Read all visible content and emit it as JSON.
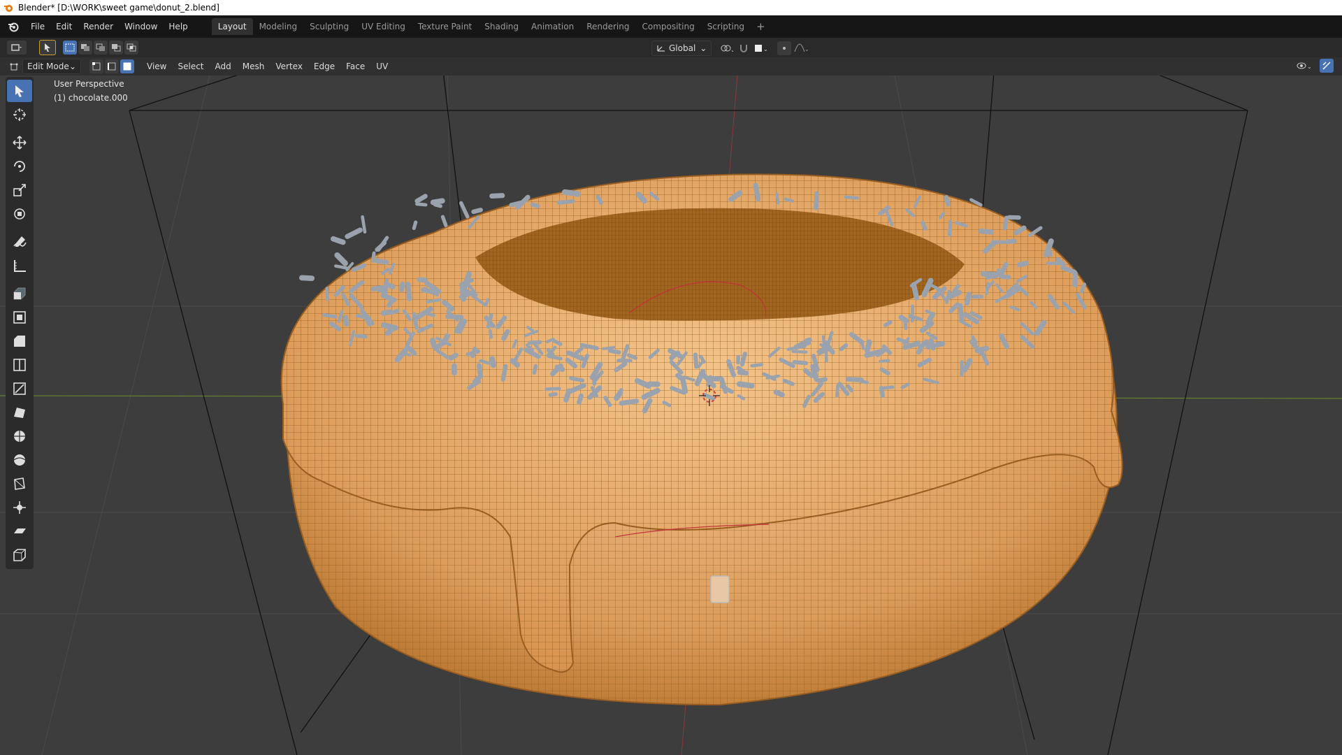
{
  "window": {
    "title": "Blender* [D:\\WORK\\sweet game\\donut_2.blend]"
  },
  "menu": [
    "File",
    "Edit",
    "Render",
    "Window",
    "Help"
  ],
  "workspaces": [
    "Layout",
    "Modeling",
    "Sculpting",
    "UV Editing",
    "Texture Paint",
    "Shading",
    "Animation",
    "Rendering",
    "Compositing",
    "Scripting"
  ],
  "active_workspace": "Layout",
  "add_workspace": "+",
  "toolbar": {
    "transform_orientation": "Global"
  },
  "edit_header": {
    "mode": "Edit Mode",
    "menus": [
      "View",
      "Select",
      "Add",
      "Mesh",
      "Vertex",
      "Edge",
      "Face",
      "UV"
    ]
  },
  "viewport": {
    "perspective": "User Perspective",
    "object": "(1) chocolate.000"
  },
  "tools": [
    {
      "name": "select-box-icon",
      "active": true
    },
    {
      "name": "cursor-icon"
    },
    {
      "name": "move-icon"
    },
    {
      "name": "rotate-icon"
    },
    {
      "name": "scale-icon"
    },
    {
      "name": "transform-icon"
    },
    {
      "name": "annotate-icon"
    },
    {
      "name": "measure-icon"
    },
    {
      "name": "extrude-icon"
    },
    {
      "name": "inset-icon"
    },
    {
      "name": "bevel-icon"
    },
    {
      "name": "loop-cut-icon"
    },
    {
      "name": "knife-icon"
    },
    {
      "name": "poly-build-icon"
    },
    {
      "name": "spin-icon"
    },
    {
      "name": "smooth-icon"
    },
    {
      "name": "edge-slide-icon"
    },
    {
      "name": "shrink-fatten-icon"
    },
    {
      "name": "shear-icon"
    },
    {
      "name": "rip-icon"
    }
  ],
  "colors": {
    "mesh": "#e0a05a",
    "wire": "#8a5a1e",
    "sprinkle": "#9aa3ad",
    "accent": "#4772b3"
  }
}
